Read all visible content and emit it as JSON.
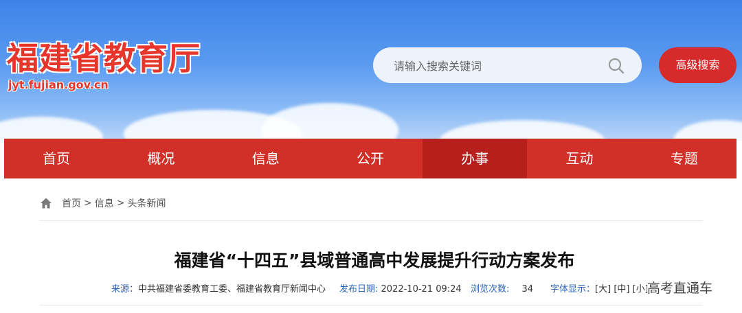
{
  "header": {
    "site_title": "福建省教育厅",
    "site_domain": "jyt.fujian.gov.cn",
    "search_placeholder": "请输入搜索关键词",
    "advanced_search_label": "高级搜索"
  },
  "nav": {
    "items": [
      {
        "label": "首页"
      },
      {
        "label": "概况"
      },
      {
        "label": "信息"
      },
      {
        "label": "公开"
      },
      {
        "label": "办事",
        "active": true
      },
      {
        "label": "互动"
      },
      {
        "label": "专题"
      }
    ]
  },
  "breadcrumb": {
    "home": "首页",
    "info": "信息",
    "headline_news": "头条新闻",
    "sep": ">"
  },
  "article": {
    "title": "福建省“十四五”县域普通高中发展提升行动方案发布",
    "source_label": "来源：",
    "source_value": "中共福建省委教育工委、福建省教育厅新闻中心",
    "date_label": "发布日期:",
    "date_value": "2022-10-21 09:24",
    "views_label": "浏览次数:",
    "views_value": "34",
    "font_label": "字体显示：",
    "font_large": "[大]",
    "font_medium": "[中]",
    "font_small": "[小]"
  },
  "watermark": "高考直通车",
  "colors": {
    "brand_red": "#d12f28",
    "active_red": "#b71f1c",
    "meta_blue": "#2a63b6"
  }
}
